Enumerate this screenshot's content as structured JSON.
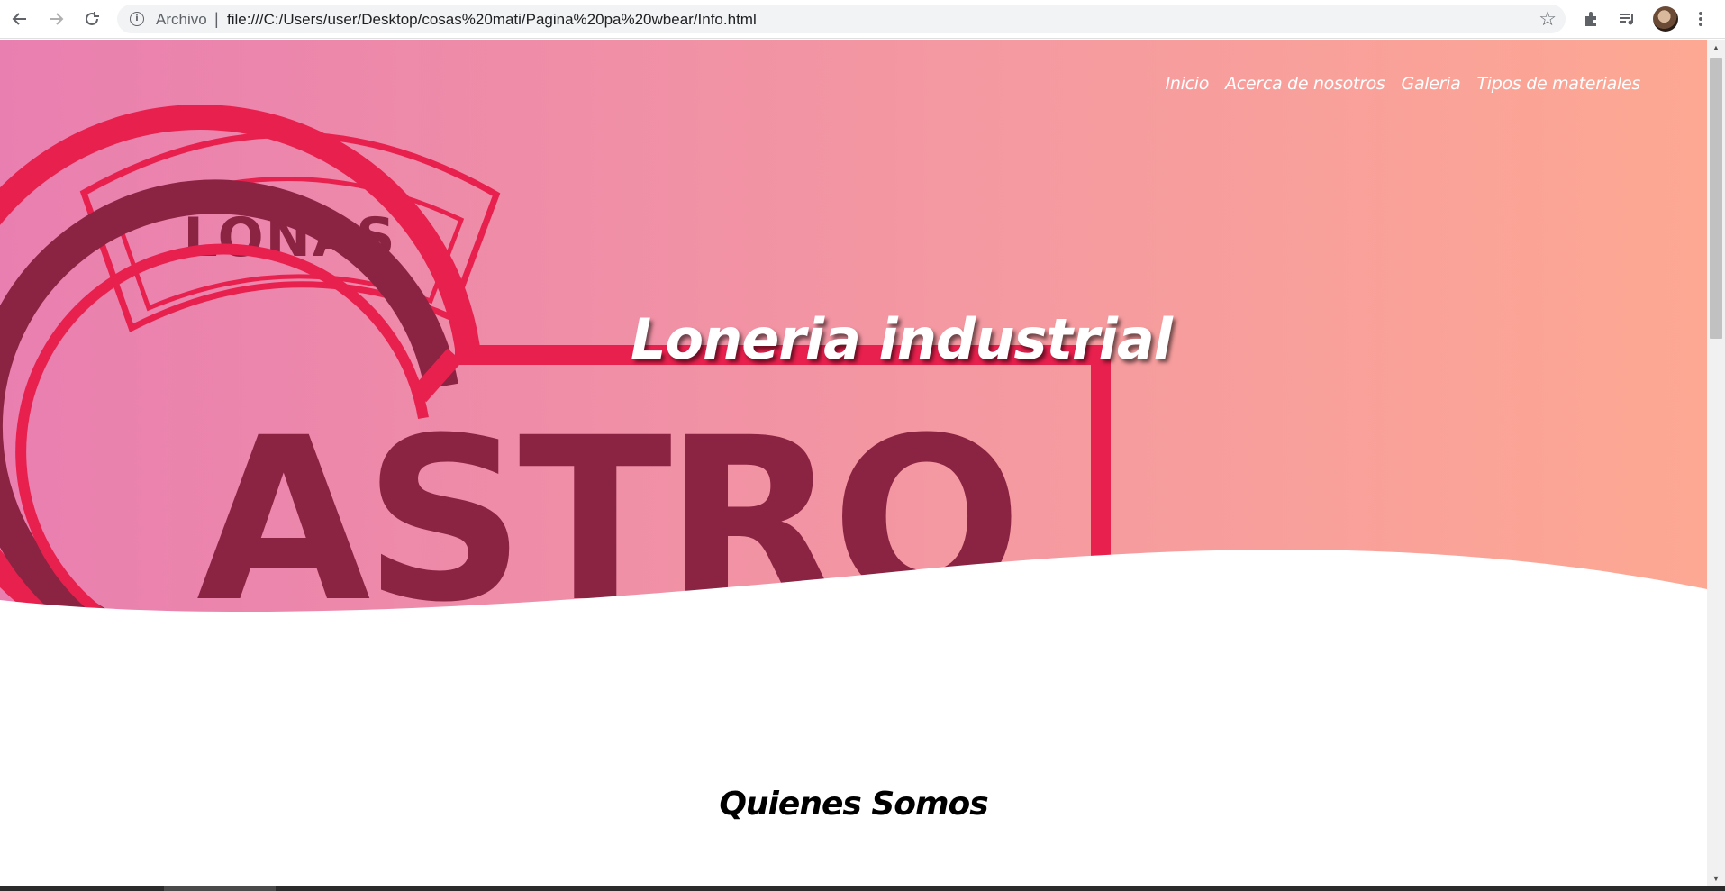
{
  "browser": {
    "scheme_label": "Archivo",
    "separator": "|",
    "url": "file:///C:/Users/user/Desktop/cosas%20mati/Pagina%20pa%20wbear/Info.html",
    "icons": [
      "back-icon",
      "forward-icon",
      "reload-icon",
      "info-icon",
      "star-icon",
      "extensions-icon",
      "media-icon",
      "profile-avatar",
      "menu-icon"
    ]
  },
  "nav": {
    "items": [
      {
        "label": "Inicio"
      },
      {
        "label": "Acerca de nosotros"
      },
      {
        "label": "Galeria"
      },
      {
        "label": "Tipos de materiales"
      }
    ]
  },
  "hero": {
    "title": "Loneria industrial",
    "logo_text_top": "LONAS",
    "logo_text_main": "ASTRO",
    "colors": {
      "gradient_start": "#e97fb0",
      "gradient_end": "#fda893",
      "logo_red": "#e8204d",
      "logo_dark": "#8b2342"
    }
  },
  "section": {
    "title": "Quienes Somos"
  }
}
